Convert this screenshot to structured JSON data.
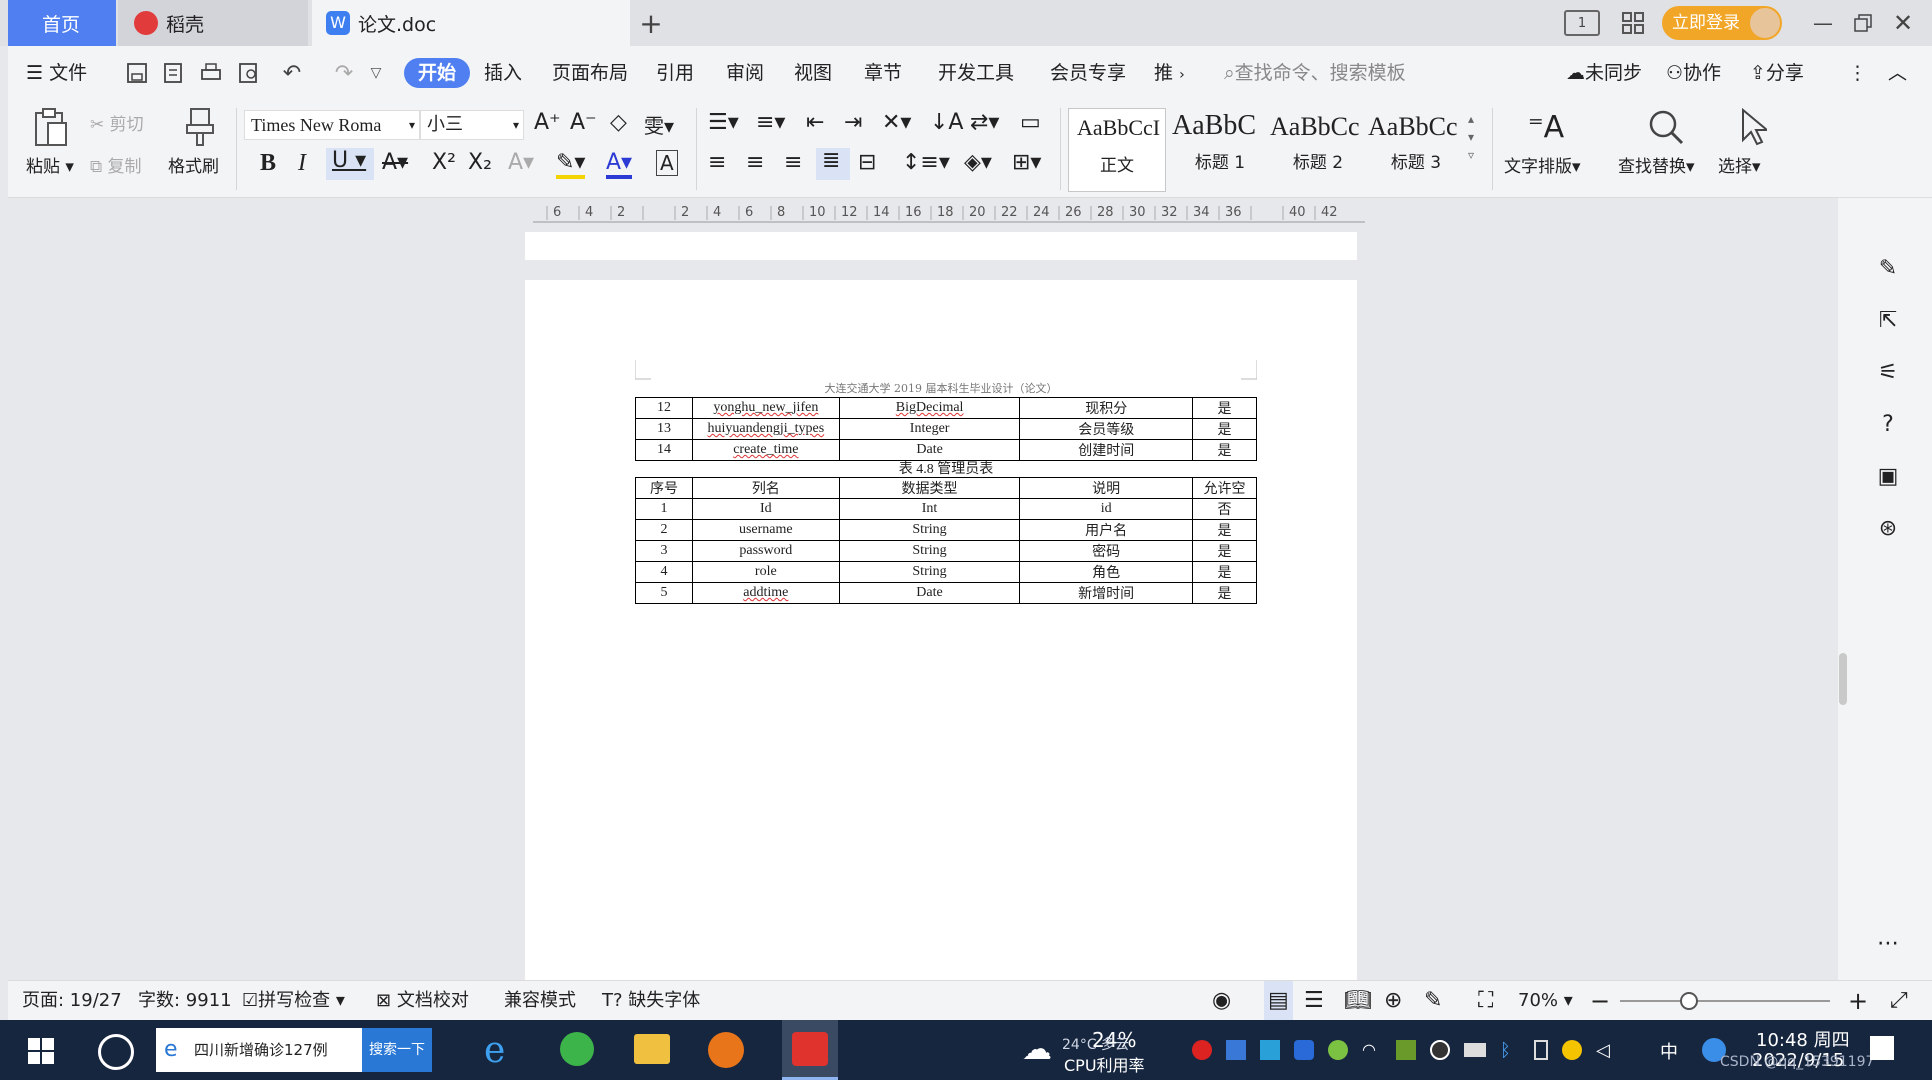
{
  "tabs": {
    "home": "首页",
    "daoke": "稻壳",
    "doc": "论文.doc"
  },
  "titlebar": {
    "login": "立即登录"
  },
  "menu": {
    "file": "文件",
    "items": [
      "开始",
      "插入",
      "页面布局",
      "引用",
      "审阅",
      "视图",
      "章节",
      "开发工具",
      "会员专享",
      "推"
    ],
    "search_placeholder": "查找命令、搜索模板",
    "sync": "未同步",
    "collab": "协作",
    "share": "分享"
  },
  "ribbon": {
    "paste": "粘贴",
    "cut": "剪切",
    "copy": "复制",
    "format_painter": "格式刷",
    "font_name": "Times New Roma",
    "font_size": "小三",
    "styles": [
      {
        "preview": "AaBbCcI",
        "name": "正文"
      },
      {
        "preview": "AaBbC",
        "name": "标题 1"
      },
      {
        "preview": "AaBbCc",
        "name": "标题 2"
      },
      {
        "preview": "AaBbCc",
        "name": "标题 3"
      }
    ],
    "text_layout": "文字排版",
    "find_replace": "查找替换",
    "select": "选择"
  },
  "ruler": {
    "ticks": [
      "6",
      "4",
      "2",
      "",
      "2",
      "4",
      "6",
      "8",
      "10",
      "12",
      "14",
      "16",
      "18",
      "20",
      "22",
      "24",
      "26",
      "28",
      "30",
      "32",
      "34",
      "36",
      "",
      "40",
      "42"
    ]
  },
  "document": {
    "header": "大连交通大学 2019 届本科生毕业设计（论文）",
    "table1_rows": [
      [
        "12",
        "yonghu_new_jifen",
        "BigDecimal",
        "现积分",
        "是"
      ],
      [
        "13",
        "huiyuandengji_types",
        "Integer",
        "会员等级",
        "是"
      ],
      [
        "14",
        "create_time",
        "Date",
        "创建时间",
        "是"
      ]
    ],
    "caption": "表 4.8 管理员表",
    "table2_header": [
      "序号",
      "列名",
      "数据类型",
      "说明",
      "允许空"
    ],
    "table2_rows": [
      [
        "1",
        "Id",
        "Int",
        "id",
        "否"
      ],
      [
        "2",
        "username",
        "String",
        "用户名",
        "是"
      ],
      [
        "3",
        "password",
        "String",
        "密码",
        "是"
      ],
      [
        "4",
        "role",
        "String",
        "角色",
        "是"
      ],
      [
        "5",
        "addtime",
        "Date",
        "新增时间",
        "是"
      ]
    ]
  },
  "status": {
    "page": "页面: 19/27",
    "words": "字数: 9911",
    "spell": "拼写检查",
    "proof": "文档校对",
    "compat": "兼容模式",
    "missing_font": "缺失字体",
    "zoom": "70%"
  },
  "taskbar": {
    "search_text": "四川新增确诊127例",
    "search_btn": "搜索一下",
    "weather": "24°C 多云",
    "cpu": "24%",
    "cpu_label": "CPU利用率",
    "ime": "中",
    "time": "10:48 周四",
    "date": "2022/9/15",
    "watermark": "CSDN @qq_15391197"
  }
}
